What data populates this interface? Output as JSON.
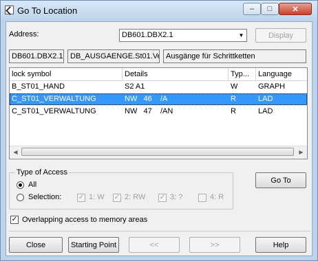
{
  "window": {
    "title": "Go To Location"
  },
  "titlebar": {
    "min": "–",
    "max": "□",
    "close": "✕"
  },
  "address": {
    "label": "Address:",
    "value": "DB601.DBX2.1",
    "display_label": "Display"
  },
  "info": {
    "field1": "DB601.DBX2.1",
    "field2": "DB_AUSGAENGE.St01.Ve",
    "field3": "Ausgänge für Schrittketten"
  },
  "table": {
    "headers": [
      "lock symbol",
      "Details",
      "Typ...",
      "Language"
    ],
    "rows": [
      {
        "symbol": "B_ST01_HAND",
        "details": "S2 A1",
        "type": "W",
        "language": "GRAPH",
        "selected": false
      },
      {
        "symbol": "C_ST01_VERWALTUNG",
        "details": "NW   46    /A",
        "type": "R",
        "language": "LAD",
        "selected": true
      },
      {
        "symbol": "C_ST01_VERWALTUNG",
        "details": "NW   47    /AN",
        "type": "R",
        "language": "LAD",
        "selected": false
      }
    ]
  },
  "type_of_access": {
    "title": "Type of Access",
    "all": "All",
    "selection": "Selection:",
    "options": [
      "1: W",
      "2: RW",
      "3: ?",
      "4: R"
    ],
    "options_checked": [
      true,
      true,
      true,
      false
    ]
  },
  "goto_label": "Go To",
  "overlap": {
    "label": "Overlapping access to memory areas",
    "checked": true
  },
  "buttons": {
    "close": "Close",
    "starting_point": "Starting Point",
    "prev": "<<",
    "next": ">>",
    "help": "Help"
  }
}
